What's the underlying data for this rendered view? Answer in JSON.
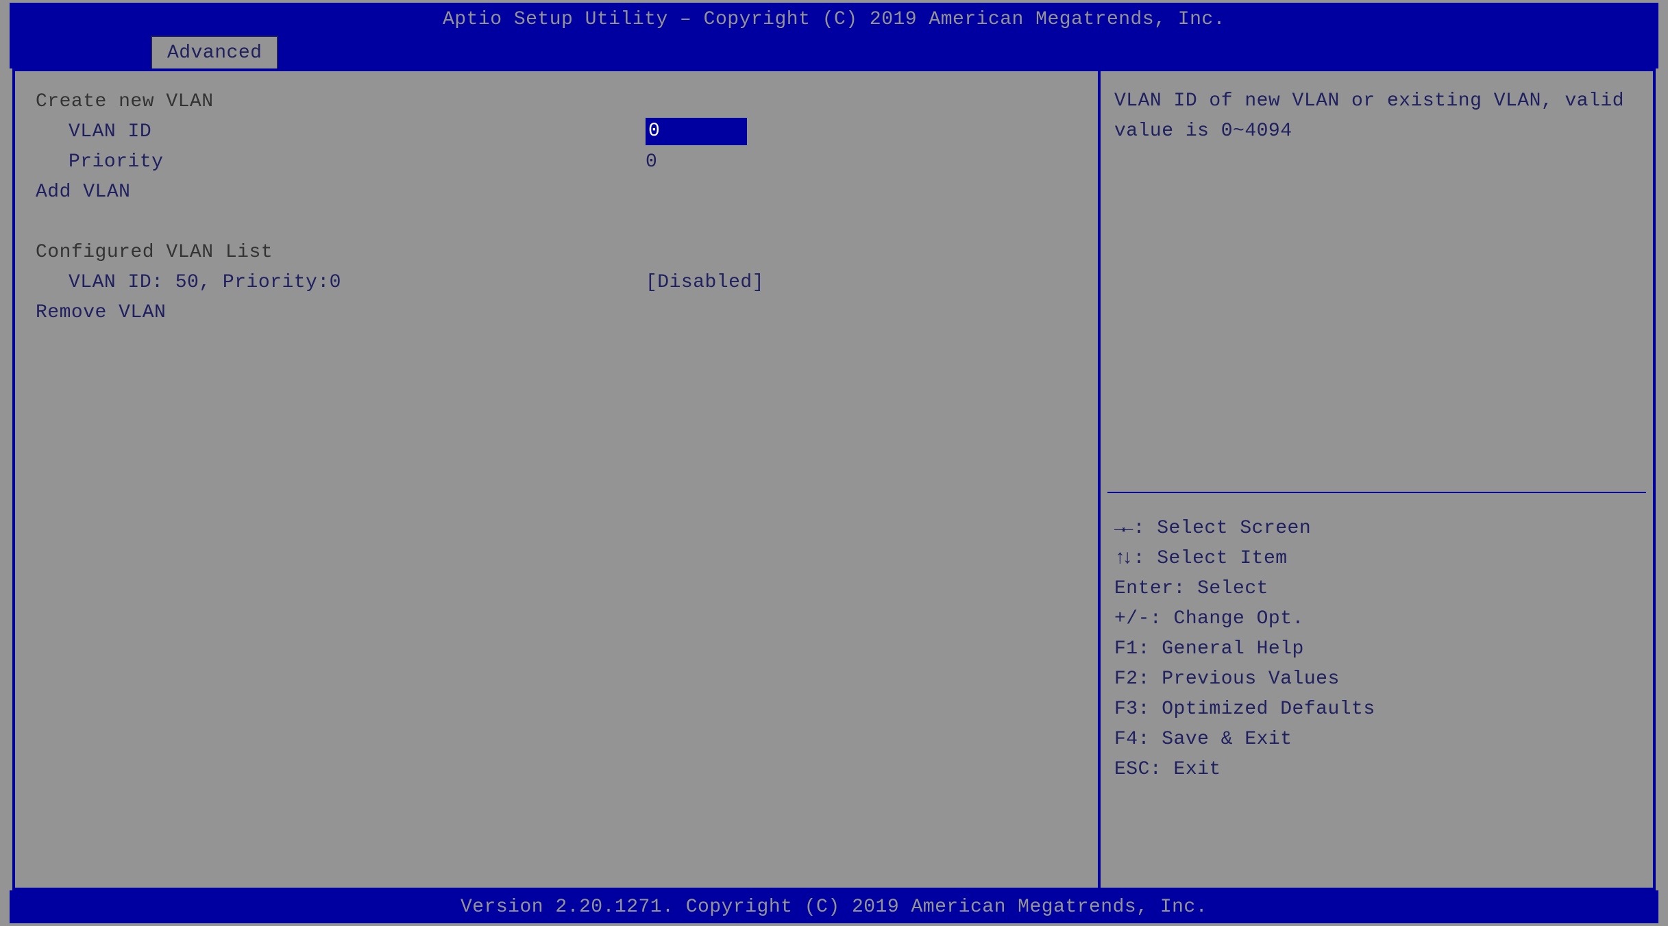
{
  "header": {
    "title": "Aptio Setup Utility – Copyright (C) 2019 American Megatrends, Inc.",
    "tab_label": "Advanced"
  },
  "main": {
    "create_section_heading": "Create new VLAN",
    "vlan_id_label": "VLAN ID",
    "vlan_id_value": "0",
    "priority_label": "Priority",
    "priority_value": "0",
    "add_vlan_label": "Add VLAN",
    "list_section_heading": "Configured VLAN List",
    "list_entry_label": "VLAN ID:  50, Priority:0",
    "list_entry_value": "[Disabled]",
    "remove_vlan_label": "Remove VLAN"
  },
  "help_text": "VLAN ID of new VLAN or existing VLAN, valid value is 0~4094",
  "keys": {
    "lr": ": Select Screen",
    "ud": ": Select Item",
    "enter": "Enter: Select",
    "pm": "+/-: Change Opt.",
    "f1": "F1: General Help",
    "f2": "F2: Previous Values",
    "f3": "F3: Optimized Defaults",
    "f4": "F4: Save & Exit",
    "esc": "ESC: Exit"
  },
  "footer": {
    "version": "Version 2.20.1271. Copyright (C) 2019 American Megatrends, Inc."
  }
}
